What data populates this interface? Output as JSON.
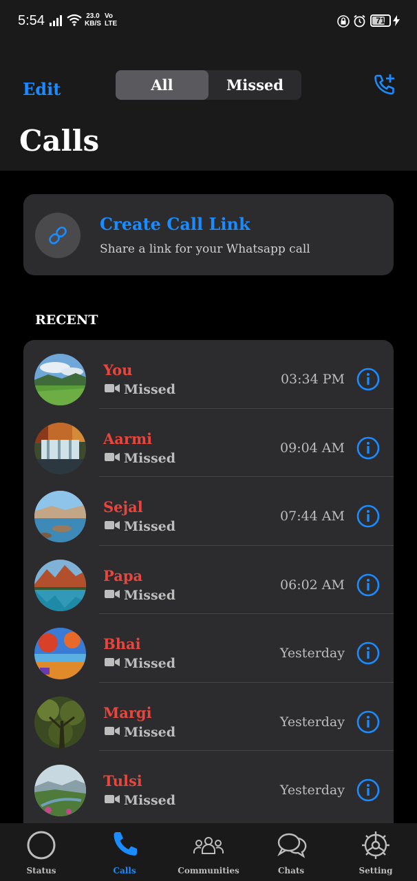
{
  "status_bar": {
    "time": "5:54",
    "net_speed_value": "23.0",
    "net_speed_unit": "KB/S",
    "volte_top": "Vo",
    "volte_bottom": "LTE",
    "battery": "71",
    "battery_level": 0.71
  },
  "header": {
    "edit_label": "Edit",
    "tabs": [
      {
        "label": "All",
        "selected": true
      },
      {
        "label": "Missed",
        "selected": false
      }
    ],
    "add_call_icon": "phone-plus-icon",
    "title": "Calls"
  },
  "call_link": {
    "icon": "link-icon",
    "title": "Create Call Link",
    "subtitle": "Share a link for your Whatsapp call"
  },
  "recent_label": "RECENT",
  "calls": [
    {
      "name": "You",
      "type_icon": "video-camera-icon",
      "status": "Missed",
      "time": "03:34 PM",
      "avatar": "meadow"
    },
    {
      "name": "Aarmi",
      "type_icon": "video-camera-icon",
      "status": "Missed",
      "time": "09:04 AM",
      "avatar": "waterfall"
    },
    {
      "name": "Sejal",
      "type_icon": "video-camera-icon",
      "status": "Missed",
      "time": "07:44 AM",
      "avatar": "lake-rocks"
    },
    {
      "name": "Papa",
      "type_icon": "video-camera-icon",
      "status": "Missed",
      "time": "06:02 AM",
      "avatar": "mountain-lake"
    },
    {
      "name": "Bhai",
      "type_icon": "video-camera-icon",
      "status": "Missed",
      "time": "Yesterday",
      "avatar": "autumn"
    },
    {
      "name": "Margi",
      "type_icon": "video-camera-icon",
      "status": "Missed",
      "time": "Yesterday",
      "avatar": "forest"
    },
    {
      "name": "Tulsi",
      "type_icon": "video-camera-icon",
      "status": "Missed",
      "time": "Yesterday",
      "avatar": "valley"
    }
  ],
  "tabbar": [
    {
      "label": "Status",
      "icon": "status-ring-icon",
      "active": false
    },
    {
      "label": "Calls",
      "icon": "phone-icon",
      "active": true
    },
    {
      "label": "Communities",
      "icon": "communities-icon",
      "active": false
    },
    {
      "label": "Chats",
      "icon": "chat-bubbles-icon",
      "active": false
    },
    {
      "label": "Setting",
      "icon": "gear-icon",
      "active": false
    }
  ],
  "colors": {
    "accent": "#1a8cff",
    "missed": "#e8453c",
    "card": "#2c2c2e",
    "background": "#000000"
  }
}
